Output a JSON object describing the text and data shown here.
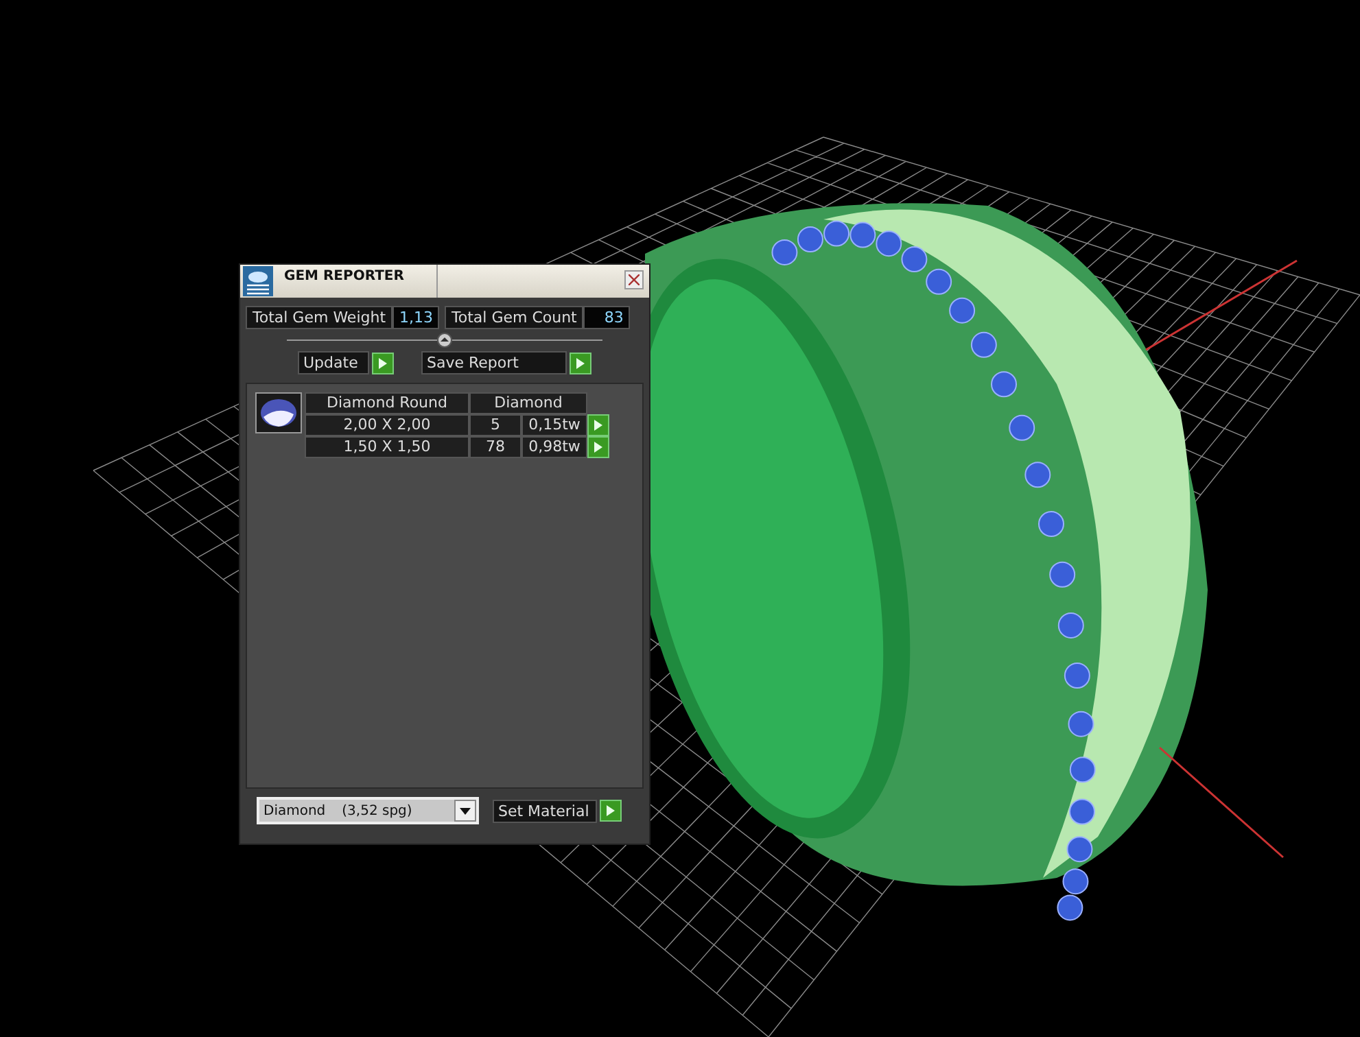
{
  "window": {
    "title": "GEM REPORTER"
  },
  "totals": [
    {
      "label": "Total Gem Weight",
      "value": "1,13"
    },
    {
      "label": "Total Gem Count",
      "value": "83"
    }
  ],
  "actions": [
    {
      "label": "Update"
    },
    {
      "label": "Save Report"
    }
  ],
  "gem_groups": [
    {
      "shape": "Diamond Round",
      "material": "Diamond",
      "rows": [
        {
          "size": "2,00 X 2,00",
          "count": "5",
          "weight": "0,15tw"
        },
        {
          "size": "1,50 X 1,50",
          "count": "78",
          "weight": "0,98tw"
        }
      ]
    }
  ],
  "material_select": {
    "value": "Diamond",
    "density": "(3,52 spg)"
  },
  "set_material_button": "Set Material"
}
